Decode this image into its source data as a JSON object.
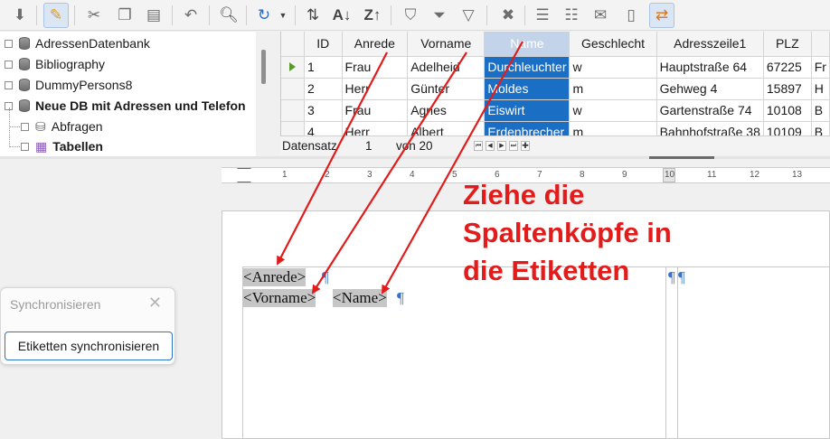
{
  "toolbar": {
    "buttons": [
      "save-icon",
      "edit-icon",
      "cut-icon",
      "copy-icon",
      "paste-icon",
      "undo-icon",
      "find-icon",
      "refresh-icon",
      "sort-icon",
      "sort-ascending-icon",
      "sort-descending-icon",
      "autofilter-icon",
      "apply-filter-icon",
      "standard-filter-icon",
      "remove-filter-icon",
      "data-to-text-icon",
      "data-to-fields-icon",
      "mail-merge-icon",
      "data-source-icon",
      "explorer-icon"
    ]
  },
  "tree": {
    "items": [
      {
        "label": "AdressenDatenbank"
      },
      {
        "label": "Bibliography"
      },
      {
        "label": "DummyPersons8"
      },
      {
        "label": "Neue DB mit Adressen und Telefon"
      },
      {
        "label": "Abfragen"
      },
      {
        "label": "Tabellen"
      }
    ]
  },
  "grid": {
    "columns": [
      "ID",
      "Anrede",
      "Vorname",
      "Name",
      "Geschlecht",
      "Adresszeile1",
      "PLZ",
      ""
    ],
    "selected_column": "Name",
    "rows": [
      [
        "1",
        "Frau",
        "Adelheid",
        "Durchleuchter",
        "w",
        "Hauptstraße 64",
        "67225",
        "Fr"
      ],
      [
        "2",
        "Herr",
        "Günter",
        "Moldes",
        "m",
        "Gehweg 4",
        "15897",
        "H"
      ],
      [
        "3",
        "Frau",
        "Agnes",
        "Eiswirt",
        "w",
        "Gartenstraße 74",
        "10108",
        "B"
      ],
      [
        "4",
        "Herr",
        "Albert",
        "Erdenbrecher",
        "m",
        "Bahnhofstraße 38",
        "10109",
        "B"
      ]
    ],
    "nav": {
      "label": "Datensatz",
      "current": "1",
      "of_label": "von 20"
    }
  },
  "ruler": {
    "marks": [
      "1",
      "2",
      "3",
      "4",
      "5",
      "6",
      "7",
      "8",
      "9",
      "10",
      "11",
      "12",
      "13"
    ]
  },
  "document": {
    "line1": [
      "<Anrede>"
    ],
    "line2": [
      "<Vorname>",
      "<Name>"
    ],
    "pilcrow": "¶"
  },
  "annotation": {
    "text": "Ziehe die\nSpaltenköpfe in\ndie Etiketten",
    "color": "#e21b1b"
  },
  "sync_panel": {
    "title": "Synchronisieren",
    "close": "✕",
    "button": "Etiketten synchronisieren"
  }
}
